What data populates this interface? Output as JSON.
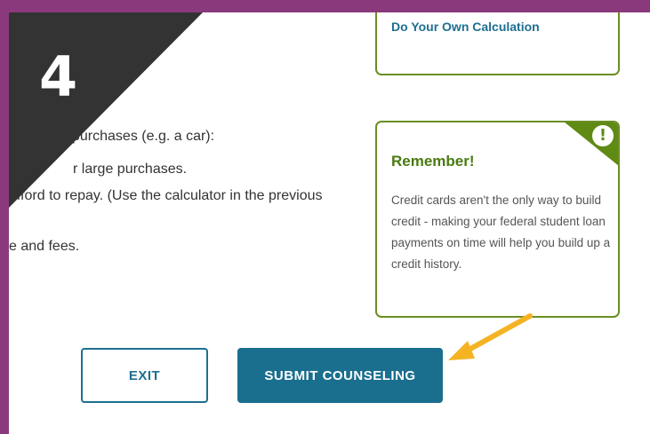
{
  "step": {
    "number": "4"
  },
  "content": {
    "line1": "purchases (e.g. a car):",
    "line2": "r large purchases.",
    "line3": "afford to repay. (Use the calculator in the previous",
    "line4": "e and fees."
  },
  "card_top": {
    "link_label": "Do Your Own Calculation"
  },
  "card_remember": {
    "icon_glyph": "!",
    "title": "Remember!",
    "body": "Credit cards aren't the only way to build credit - making your federal student loan payments on time will help you build up a credit history."
  },
  "buttons": {
    "exit_label": "EXIT",
    "submit_label": "SUBMIT COUNSELING"
  },
  "colors": {
    "frame": "#8a3a7c",
    "accent_blue": "#1a6e8e",
    "accent_green": "#5f8a14",
    "step_badge": "#333333",
    "arrow": "#f5b324"
  }
}
